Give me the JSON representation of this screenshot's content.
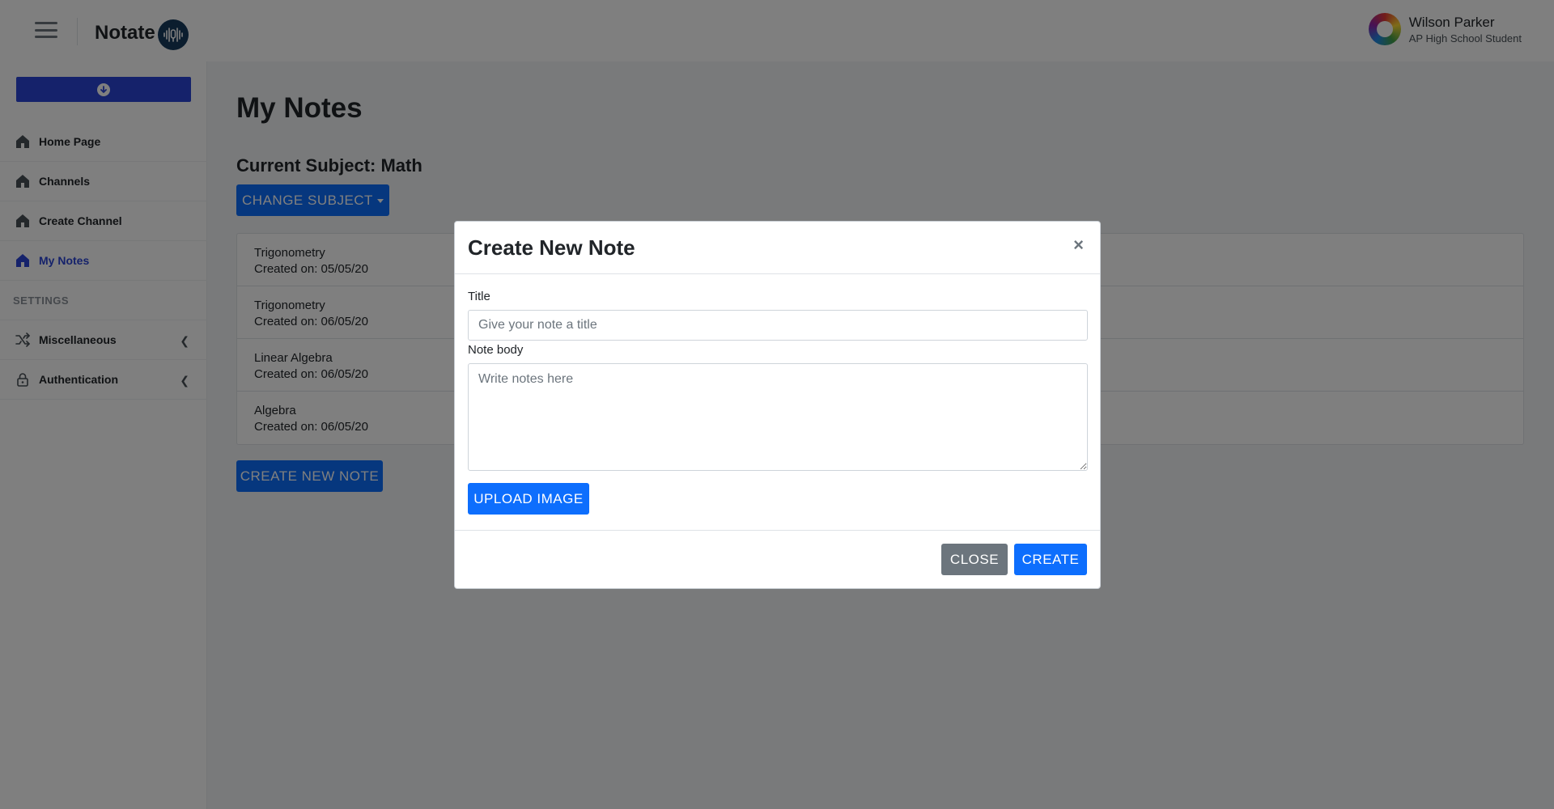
{
  "header": {
    "brand": "Notate",
    "user": {
      "name": "Wilson Parker",
      "role": "AP High School Student"
    }
  },
  "sidebar": {
    "items": [
      {
        "label": "Home Page",
        "icon": "home-icon"
      },
      {
        "label": "Channels",
        "icon": "home-icon"
      },
      {
        "label": "Create Channel",
        "icon": "home-icon"
      },
      {
        "label": "My Notes",
        "icon": "home-icon",
        "active": true
      }
    ],
    "section_label": "SETTINGS",
    "settings_items": [
      {
        "label": "Miscellaneous",
        "icon": "shuffle-icon"
      },
      {
        "label": "Authentication",
        "icon": "lock-icon"
      }
    ],
    "accent_color": "#2a44d6"
  },
  "main": {
    "title": "My Notes",
    "subject_title": "Current Subject: Math",
    "change_subject_label": "CHANGE SUBJECT",
    "notes": [
      {
        "title": "Trigonometry",
        "created": "Created on: 05/05/20"
      },
      {
        "title": "Trigonometry",
        "created": "Created on: 06/05/20"
      },
      {
        "title": "Linear Algebra",
        "created": "Created on: 06/05/20"
      },
      {
        "title": "Algebra",
        "created": "Created on: 06/05/20"
      }
    ],
    "create_note_label": "CREATE NEW NOTE"
  },
  "modal": {
    "title": "Create New Note",
    "close_symbol": "×",
    "title_label": "Title",
    "title_placeholder": "Give your note a title",
    "body_label": "Note body",
    "body_placeholder": "Write notes here",
    "upload_label": "UPLOAD IMAGE",
    "close_label": "CLOSE",
    "create_label": "CREATE"
  },
  "colors": {
    "primary": "#0d6efd",
    "secondary": "#6c757d"
  }
}
